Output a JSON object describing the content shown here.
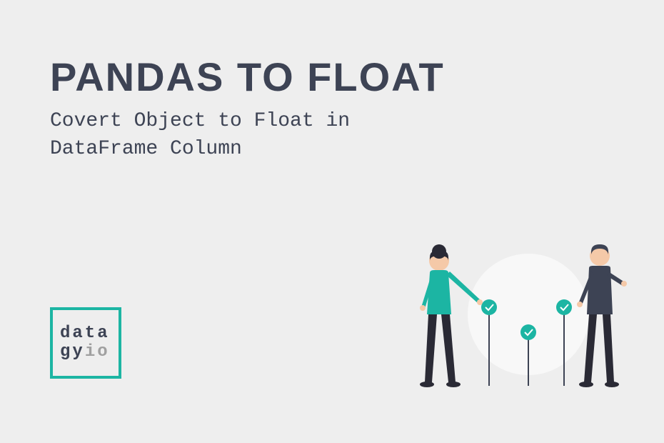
{
  "title": "PANDAS TO FLOAT",
  "subtitle_line1": "Covert Object to Float in",
  "subtitle_line2": "DataFrame Column",
  "logo": {
    "line1": "data",
    "line2_part1": "gy",
    "line2_part2": "io"
  }
}
